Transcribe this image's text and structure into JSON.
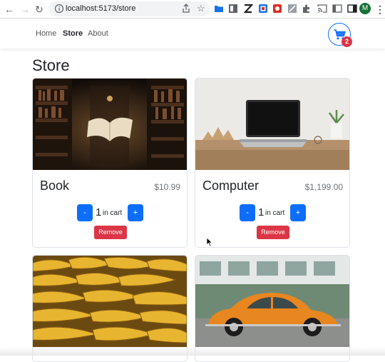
{
  "browser": {
    "url": "localhost:5173/store",
    "profile_initial": "M"
  },
  "navbar": {
    "links": [
      "Home",
      "Store",
      "About"
    ],
    "active": "Store",
    "cart_count": "2"
  },
  "page": {
    "title": "Store"
  },
  "products": [
    {
      "name": "Book",
      "price": "$10.99",
      "quantity": "1",
      "in_cart_label": "in cart",
      "decrement_label": "-",
      "increment_label": "+",
      "remove_label": "Remove"
    },
    {
      "name": "Computer",
      "price": "$1,199.00",
      "quantity": "1",
      "in_cart_label": "in cart",
      "decrement_label": "-",
      "increment_label": "+",
      "remove_label": "Remove"
    },
    {
      "name": "Banana"
    },
    {
      "name": "Car"
    }
  ],
  "colors": {
    "primary": "#0d6efd",
    "danger": "#dc3545",
    "profile": "#137333"
  },
  "icons": {
    "cart": "shopping-cart-icon",
    "back": "arrow-left-icon",
    "forward": "arrow-right-icon",
    "reload": "reload-icon"
  }
}
